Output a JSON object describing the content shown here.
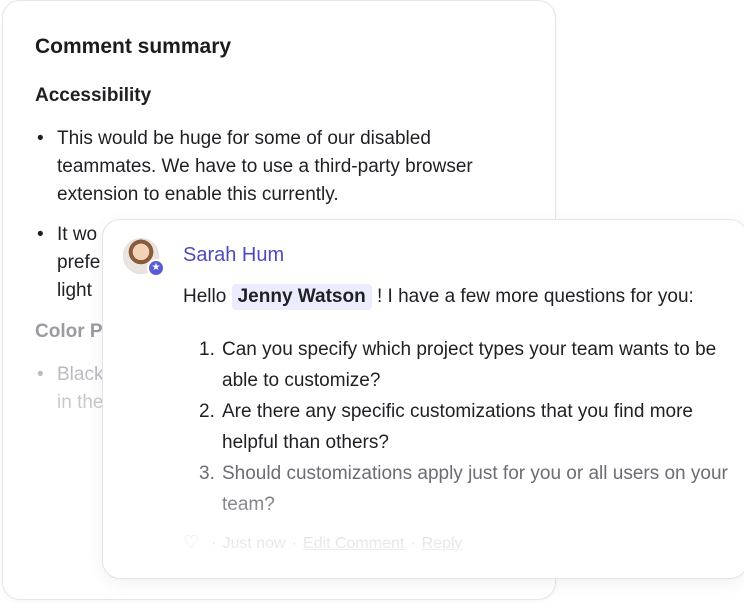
{
  "summary": {
    "title": "Comment summary",
    "sections": [
      {
        "heading": "Accessibility",
        "items": [
          "This would be huge for some of our disabled teammates. We have to use a third-party browser extension to enable this currently.",
          "It wo",
          "prefe",
          "light"
        ]
      },
      {
        "heading": "Color P",
        "items": [
          "Black",
          "in the"
        ]
      }
    ],
    "bullet": "•"
  },
  "comment": {
    "author": "Sarah Hum",
    "greeting_prefix": "Hello",
    "mention": "Jenny Watson",
    "greeting_suffix": "! I have a few more questions for you:",
    "questions": [
      {
        "num": "1.",
        "text": "Can you specify which project types your team wants to be able to customize?"
      },
      {
        "num": "2.",
        "text": "Are there any specific customizations that you find more helpful than others?"
      },
      {
        "num": "3.",
        "text": "Should customizations apply just for you or all users on your team?"
      }
    ],
    "footer": {
      "heart_icon": "heart-outline-icon",
      "heart_glyph": "♡",
      "timestamp": "Just now",
      "edit_label": "Edit Comment",
      "reply_label": "Reply",
      "separator": "·"
    },
    "badge_icon": "star-badge-icon",
    "badge_glyph": "★"
  },
  "colors": {
    "author": "#4b4bbd",
    "mention_bg": "#ececff",
    "badge": "#5b5bd6"
  }
}
